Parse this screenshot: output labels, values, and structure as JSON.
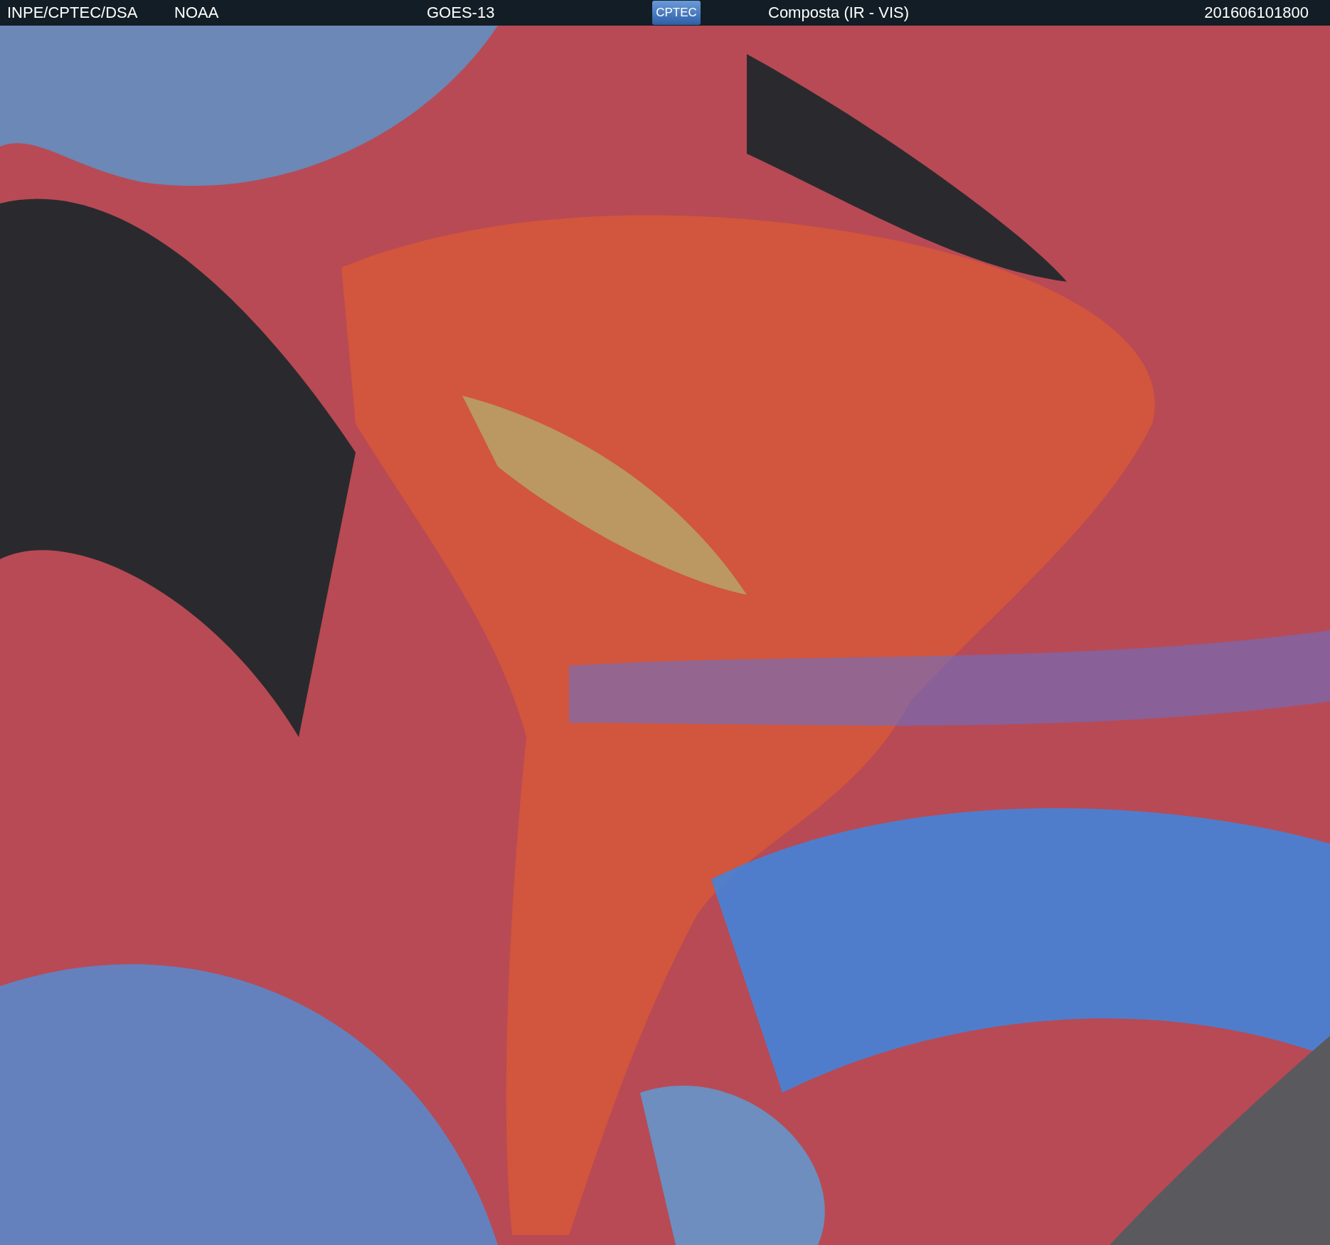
{
  "header": {
    "agency": "INPE/CPTEC/DSA",
    "partner": "NOAA",
    "satellite": "GOES-13",
    "logo": "CPTEC",
    "product": "Composta (IR - VIS)",
    "timestamp": "201606101800"
  }
}
